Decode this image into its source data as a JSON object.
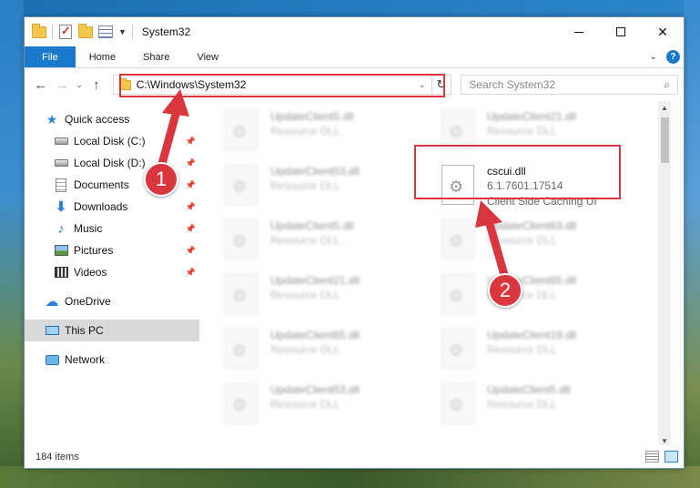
{
  "window": {
    "title": "System32",
    "controls": {
      "minimize": "",
      "maximize": "",
      "close": "✕"
    }
  },
  "ribbon": {
    "tabs": [
      "File",
      "Home",
      "Share",
      "View"
    ],
    "help": "?"
  },
  "nav": {
    "back": "←",
    "forward": "→",
    "recent": "⌄",
    "up": "↑",
    "address": "C:\\Windows\\System32",
    "address_dropdown": "⌄",
    "refresh": "↻",
    "search_placeholder": "Search System32",
    "search_icon": "⌕"
  },
  "sidebar": {
    "quick_access": "Quick access",
    "items": [
      {
        "label": "Local Disk (C:)",
        "icon": "drive-icon"
      },
      {
        "label": "Local Disk (D:)",
        "icon": "drive-icon"
      },
      {
        "label": "Documents",
        "icon": "documents-icon"
      },
      {
        "label": "Downloads",
        "icon": "downloads-icon"
      },
      {
        "label": "Music",
        "icon": "music-icon"
      },
      {
        "label": "Pictures",
        "icon": "pictures-icon"
      },
      {
        "label": "Videos",
        "icon": "videos-icon"
      }
    ],
    "onedrive": "OneDrive",
    "this_pc": "This PC",
    "network": "Network"
  },
  "files": {
    "left_column": [
      {
        "name": "UpdateClient5.dll",
        "desc": "Resource DLL"
      },
      {
        "name": "UpdateClient53.dll",
        "desc": "Resource DLL"
      },
      {
        "name": "UpdateClient5.dll",
        "desc": "Resource DLL"
      },
      {
        "name": "UpdateClient21.dll",
        "desc": "Resource DLL"
      },
      {
        "name": "UpdateClient65.dll",
        "desc": "Resource DLL"
      },
      {
        "name": "UpdateClient53.dll",
        "desc": "Resource DLL"
      }
    ],
    "right_column": [
      {
        "name": "UpdateClient21.dll",
        "desc": "Resource DLL"
      },
      {
        "name": "UpdateClient63.dll",
        "desc": "Resource DLL"
      },
      {
        "name": "UpdateClient65.dll",
        "desc": "Resource DLL"
      },
      {
        "name": "UpdateClient19.dll",
        "desc": "Resource DLL"
      },
      {
        "name": "UpdateClient5.dll",
        "desc": "Resource DLL"
      }
    ],
    "selected": {
      "name": "cscui.dll",
      "version": "6.1.7601.17514",
      "desc": "Client Side Caching UI"
    }
  },
  "status": {
    "item_count": "184 items"
  },
  "annotations": {
    "step1": "1",
    "step2": "2",
    "color": "#d9363e"
  }
}
